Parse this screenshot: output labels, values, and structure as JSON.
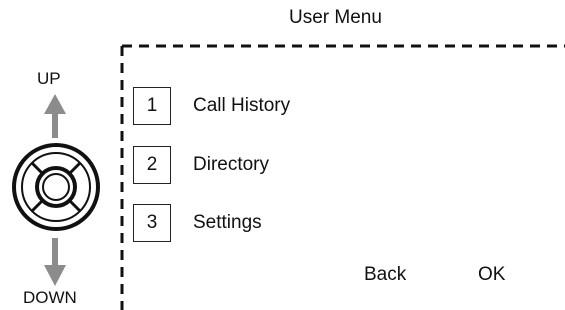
{
  "menu": {
    "title": "User Menu",
    "items": [
      {
        "number": "1",
        "label": "Call History"
      },
      {
        "number": "2",
        "label": "Directory"
      },
      {
        "number": "3",
        "label": "Settings"
      }
    ]
  },
  "navigation": {
    "up_label": "UP",
    "down_label": "DOWN",
    "icons": [
      "up-arrow-icon",
      "navigation-pad-icon",
      "down-arrow-icon"
    ]
  },
  "softkeys": {
    "back_label": "Back",
    "ok_label": "OK"
  },
  "colors": {
    "arrow_gray": "#8c8c8c",
    "line": "#111111",
    "background": "#ffffff"
  }
}
